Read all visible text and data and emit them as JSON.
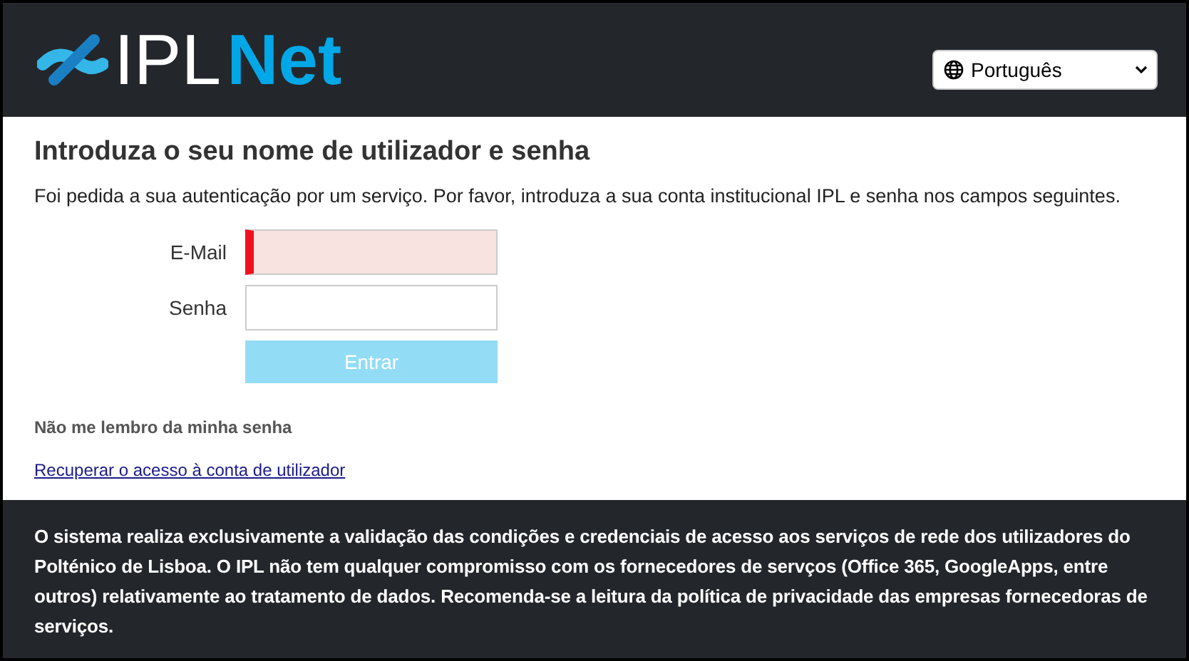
{
  "header": {
    "logo": {
      "part_1": "IPL",
      "part_2": "Net"
    },
    "language_select": {
      "value": "Português"
    }
  },
  "login": {
    "title": "Introduza o seu nome de utilizador e senha",
    "intro": "Foi pedida a sua autenticação por um serviço. Por favor, introduza a sua conta institucional IPL e senha nos campos seguintes.",
    "fields": [
      {
        "label": "E-Mail",
        "invalid": true
      },
      {
        "label": "Senha",
        "invalid": false
      }
    ],
    "submit": {
      "label": "Entrar",
      "disabled": true
    },
    "forgot_heading": "Não me lembro da minha senha",
    "recover_link": "Recuperar o acesso à conta de utilizador"
  },
  "footer": {
    "notice": "O sistema realiza exclusivamente a validação das condições e credenciais de acesso aos serviços de rede dos utilizadores do Polténico de Lisboa. O IPL não tem qualquer compromisso com os fornecedores de servços (Office 365, GoogleApps, entre outros) relativamente ao tratamento de dados. Recomenda-se a leitura da política de privacidade das empresas fornecedoras de serviços."
  }
}
